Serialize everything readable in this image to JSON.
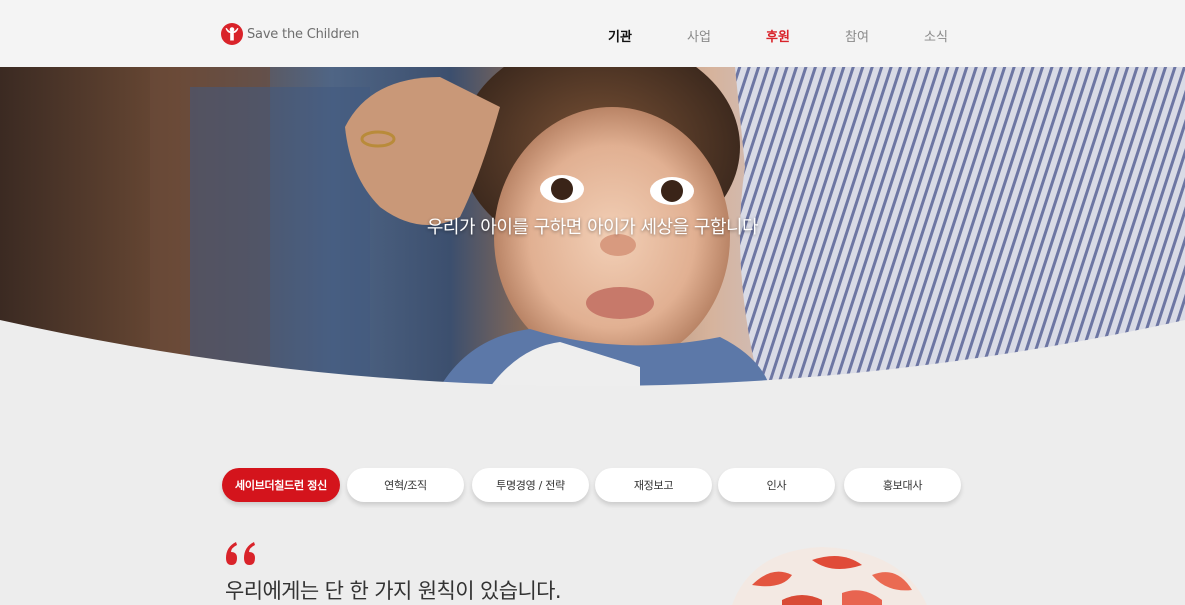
{
  "brand": {
    "name": "Save the Children",
    "accent_color": "#d4141c",
    "logo_icon": "child-arms-raised-icon"
  },
  "nav": {
    "items": [
      {
        "label": "기관",
        "state": "active"
      },
      {
        "label": "사업",
        "state": "normal"
      },
      {
        "label": "후원",
        "state": "accent"
      },
      {
        "label": "참여",
        "state": "normal"
      },
      {
        "label": "소식",
        "state": "normal"
      }
    ]
  },
  "hero": {
    "caption": "우리가 아이를 구하면 아이가 세상을 구합니다"
  },
  "tabs": [
    {
      "label": "세이브더칠드런 정신",
      "active": true
    },
    {
      "label": "연혁/조직",
      "active": false
    },
    {
      "label": "투명경영 / 전략",
      "active": false
    },
    {
      "label": "재정보고",
      "active": false
    },
    {
      "label": "인사",
      "active": false
    },
    {
      "label": "홍보대사",
      "active": false
    }
  ],
  "intro": {
    "quote_icon": "quote-mark-icon",
    "headline": "우리에게는 단 한 가지 원칙이 있습니다."
  }
}
